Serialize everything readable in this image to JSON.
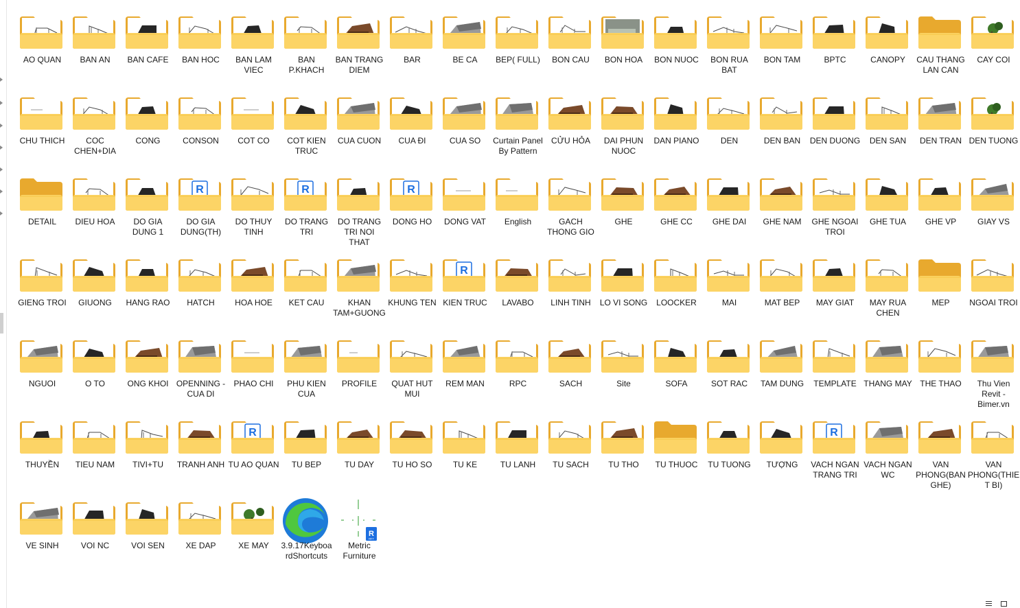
{
  "colors": {
    "folder_back": "#E8A92E",
    "folder_front": "#FCD466",
    "folder_front_edge": "#F6C644",
    "paper": "#FFFFFF",
    "edge_blue": "#1E7BD8",
    "edge_green": "#4FC73E",
    "revit_blue": "#1D6FE0",
    "label_text": "#1A1A1A"
  },
  "folders": [
    {
      "label": "AO QUAN",
      "preview": "wire"
    },
    {
      "label": "BAN AN",
      "preview": "wire"
    },
    {
      "label": "BAN CAFE",
      "preview": "dark"
    },
    {
      "label": "BAN HOC",
      "preview": "wire"
    },
    {
      "label": "BAN LAM VIEC",
      "preview": "dark"
    },
    {
      "label": "BAN P.KHACH",
      "preview": "wire"
    },
    {
      "label": "BAN TRANG DIEM",
      "preview": "brown"
    },
    {
      "label": "BAR",
      "preview": "wire"
    },
    {
      "label": "BE CA",
      "preview": "gray"
    },
    {
      "label": "BEP( FULL)",
      "preview": "wire"
    },
    {
      "label": "BON CAU",
      "preview": "wire"
    },
    {
      "label": "BON HOA",
      "preview": "photo"
    },
    {
      "label": "BON NUOC",
      "preview": "dark"
    },
    {
      "label": "BON RUA BAT",
      "preview": "wire"
    },
    {
      "label": "BON TAM",
      "preview": "wire"
    },
    {
      "label": "BPTC",
      "preview": "dark"
    },
    {
      "label": "CANOPY",
      "preview": "dark"
    },
    {
      "label": "CAU THANG LAN CAN",
      "preview": "empty"
    },
    {
      "label": "CAY COI",
      "preview": "green"
    },
    {
      "label": "CHU THICH",
      "preview": "paper"
    },
    {
      "label": "COC CHEN+DIA",
      "preview": "wire"
    },
    {
      "label": "CONG",
      "preview": "dark"
    },
    {
      "label": "CONSON",
      "preview": "wire"
    },
    {
      "label": "COT CO",
      "preview": "paper"
    },
    {
      "label": "COT KIEN TRUC",
      "preview": "dark"
    },
    {
      "label": "CUA CUON",
      "preview": "gray"
    },
    {
      "label": "CUA ĐI",
      "preview": "dark"
    },
    {
      "label": "CUA SO",
      "preview": "gray"
    },
    {
      "label": "Curtain Panel By Pattern",
      "preview": "gray"
    },
    {
      "label": "CỬU HỎA",
      "preview": "brown"
    },
    {
      "label": "DAI PHUN NUOC",
      "preview": "brown"
    },
    {
      "label": "DAN PIANO",
      "preview": "dark"
    },
    {
      "label": "DEN",
      "preview": "wire"
    },
    {
      "label": "DEN BAN",
      "preview": "wire"
    },
    {
      "label": "DEN DUONG",
      "preview": "dark"
    },
    {
      "label": "DEN SAN",
      "preview": "wire"
    },
    {
      "label": "DEN TRAN",
      "preview": "gray"
    },
    {
      "label": "DEN TUONG",
      "preview": "green"
    },
    {
      "label": "DETAIL",
      "preview": "empty"
    },
    {
      "label": "DIEU HOA",
      "preview": "wire"
    },
    {
      "label": "DO GIA DUNG 1",
      "preview": "dark"
    },
    {
      "label": "DO GIA DUNG(TH)",
      "preview": "revit"
    },
    {
      "label": "DO THUY TINH",
      "preview": "wire"
    },
    {
      "label": "DO TRANG TRI",
      "preview": "revit"
    },
    {
      "label": "DO TRANG TRI NOI THAT",
      "preview": "dark"
    },
    {
      "label": "DONG HO",
      "preview": "revit"
    },
    {
      "label": "DONG VAT",
      "preview": "paper"
    },
    {
      "label": "English",
      "preview": "paper"
    },
    {
      "label": "GACH THONG GIO",
      "preview": "wire"
    },
    {
      "label": "GHE",
      "preview": "brown"
    },
    {
      "label": "GHE CC",
      "preview": "brown"
    },
    {
      "label": "GHE DAI",
      "preview": "dark"
    },
    {
      "label": "GHE NAM",
      "preview": "brown"
    },
    {
      "label": "GHE NGOAI TROI",
      "preview": "wire"
    },
    {
      "label": "GHE TUA",
      "preview": "dark"
    },
    {
      "label": "GHE VP",
      "preview": "dark"
    },
    {
      "label": "GIAY VS",
      "preview": "gray"
    },
    {
      "label": "GIENG TROI",
      "preview": "wire"
    },
    {
      "label": "GIUONG",
      "preview": "dark"
    },
    {
      "label": "HANG RAO",
      "preview": "dark"
    },
    {
      "label": "HATCH",
      "preview": "wire"
    },
    {
      "label": "HOA HOE",
      "preview": "brown"
    },
    {
      "label": "KET CAU",
      "preview": "wire"
    },
    {
      "label": "KHAN TAM+GUONG",
      "preview": "gray"
    },
    {
      "label": "KHUNG TEN",
      "preview": "wire"
    },
    {
      "label": "KIEN TRUC",
      "preview": "revit"
    },
    {
      "label": "LAVABO",
      "preview": "brown"
    },
    {
      "label": "LINH TINH",
      "preview": "wire"
    },
    {
      "label": "LO VI SONG",
      "preview": "dark"
    },
    {
      "label": "LOOCKER",
      "preview": "wire"
    },
    {
      "label": "MAI",
      "preview": "wire"
    },
    {
      "label": "MAT BEP",
      "preview": "wire"
    },
    {
      "label": "MAY GIAT",
      "preview": "dark"
    },
    {
      "label": "MAY RUA CHEN",
      "preview": "wire"
    },
    {
      "label": "MEP",
      "preview": "empty"
    },
    {
      "label": "NGOAI TROI",
      "preview": "wire"
    },
    {
      "label": "NGUOI",
      "preview": "gray"
    },
    {
      "label": "O TO",
      "preview": "dark"
    },
    {
      "label": "ONG KHOI",
      "preview": "brown"
    },
    {
      "label": "OPENNING -CUA DI",
      "preview": "gray"
    },
    {
      "label": "PHAO CHI",
      "preview": "paper"
    },
    {
      "label": "PHU KIEN CUA",
      "preview": "gray"
    },
    {
      "label": "PROFILE",
      "preview": "paper"
    },
    {
      "label": "QUAT HUT MUI",
      "preview": "wire"
    },
    {
      "label": "REM MAN",
      "preview": "gray"
    },
    {
      "label": "RPC",
      "preview": "wire"
    },
    {
      "label": "SACH",
      "preview": "brown"
    },
    {
      "label": "Site",
      "preview": "wire"
    },
    {
      "label": "SOFA",
      "preview": "dark"
    },
    {
      "label": "SOT RAC",
      "preview": "dark"
    },
    {
      "label": "TAM DUNG",
      "preview": "gray"
    },
    {
      "label": "TEMPLATE",
      "preview": "wire"
    },
    {
      "label": "THANG MAY",
      "preview": "gray"
    },
    {
      "label": "THE THAO",
      "preview": "wire"
    },
    {
      "label": "Thu Vien Revit - Bimer.vn",
      "preview": "gray"
    },
    {
      "label": "THUYỀN",
      "preview": "dark"
    },
    {
      "label": "TIEU NAM",
      "preview": "wire"
    },
    {
      "label": "TIVI+TU",
      "preview": "wire"
    },
    {
      "label": "TRANH ANH",
      "preview": "brown"
    },
    {
      "label": "TU AO QUAN",
      "preview": "revit"
    },
    {
      "label": "TU BEP",
      "preview": "dark"
    },
    {
      "label": "TU DAY",
      "preview": "brown"
    },
    {
      "label": "TU HO SO",
      "preview": "brown"
    },
    {
      "label": "TU KE",
      "preview": "wire"
    },
    {
      "label": "TU LANH",
      "preview": "dark"
    },
    {
      "label": "TU SACH",
      "preview": "wire"
    },
    {
      "label": "TU THO",
      "preview": "brown"
    },
    {
      "label": "TU THUOC",
      "preview": "empty"
    },
    {
      "label": "TU TUONG",
      "preview": "dark"
    },
    {
      "label": "TƯỢNG",
      "preview": "dark"
    },
    {
      "label": "VACH NGAN TRANG TRI",
      "preview": "revit"
    },
    {
      "label": "VACH NGAN WC",
      "preview": "gray"
    },
    {
      "label": "VAN PHONG(BAN GHE)",
      "preview": "brown"
    },
    {
      "label": "VAN PHONG(THIET BI)",
      "preview": "wire"
    },
    {
      "label": "VE SINH",
      "preview": "gray"
    },
    {
      "label": "VOI NC",
      "preview": "dark"
    },
    {
      "label": "VOI SEN",
      "preview": "dark"
    },
    {
      "label": "XE DAP",
      "preview": "wire"
    },
    {
      "label": "XE MAY",
      "preview": "green"
    }
  ],
  "files": [
    {
      "label": "3.9.17KeyboardShortcuts",
      "icon": "edge-browser-icon"
    },
    {
      "label": "Metric Furniture",
      "icon": "revit-family-icon",
      "badge": "R",
      "badge_sub": "RFT"
    }
  ],
  "revit_glyph": "R"
}
